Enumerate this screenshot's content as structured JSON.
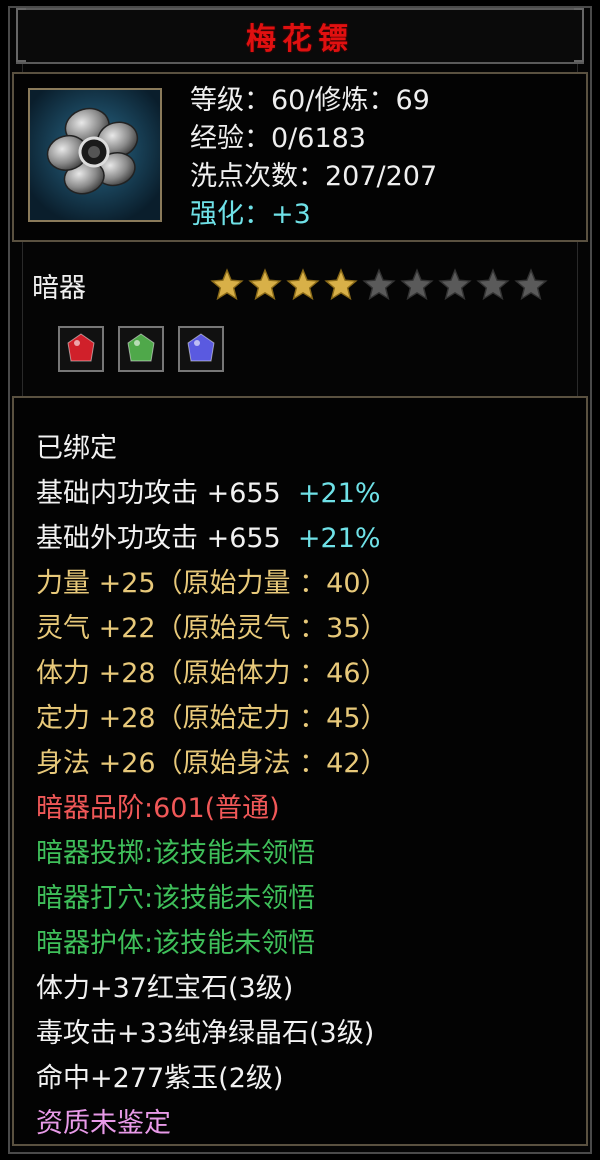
{
  "item": {
    "name": "梅花镖",
    "level_line": "等级：60/修炼：69",
    "exp_line": "经验：0/6183",
    "wash_line": "洗点次数：207/207",
    "enhance_label": "强化：",
    "enhance_value": "+3",
    "type": "暗器",
    "stars_filled": 4,
    "stars_total": 9
  },
  "gems": [
    {
      "name": "ruby-gem-icon",
      "color": "#d0202a"
    },
    {
      "name": "green-crystal-gem-icon",
      "color": "#4fa84a"
    },
    {
      "name": "purple-jade-gem-icon",
      "color": "#5a5ae0"
    }
  ],
  "details": {
    "bound": "已绑定",
    "inner_attack_label": "基础内功攻击 +655",
    "inner_attack_bonus": "+21%",
    "outer_attack_label": "基础外功攻击 +655",
    "outer_attack_bonus": "+21%",
    "strength": "力量 +25（原始力量  ：40）",
    "spirit": "灵气 +22（原始灵气  ：35）",
    "vitality": "体力 +28（原始体力  ：46）",
    "focus": "定力 +28（原始定力  ：45）",
    "agility": "身法 +26（原始身法  ：42）",
    "grade": "暗器品阶:601(普通)",
    "skill_throw": "暗器投掷:该技能未领悟",
    "skill_acupoint": "暗器打穴:该技能未领悟",
    "skill_guard": "暗器护体:该技能未领悟",
    "gem_line_1": "体力+37红宝石(3级)",
    "gem_line_2": "毒攻击+33纯净绿晶石(3级)",
    "gem_line_3": "命中+277紫玉(2级)",
    "aptitude": "资质未鉴定"
  }
}
